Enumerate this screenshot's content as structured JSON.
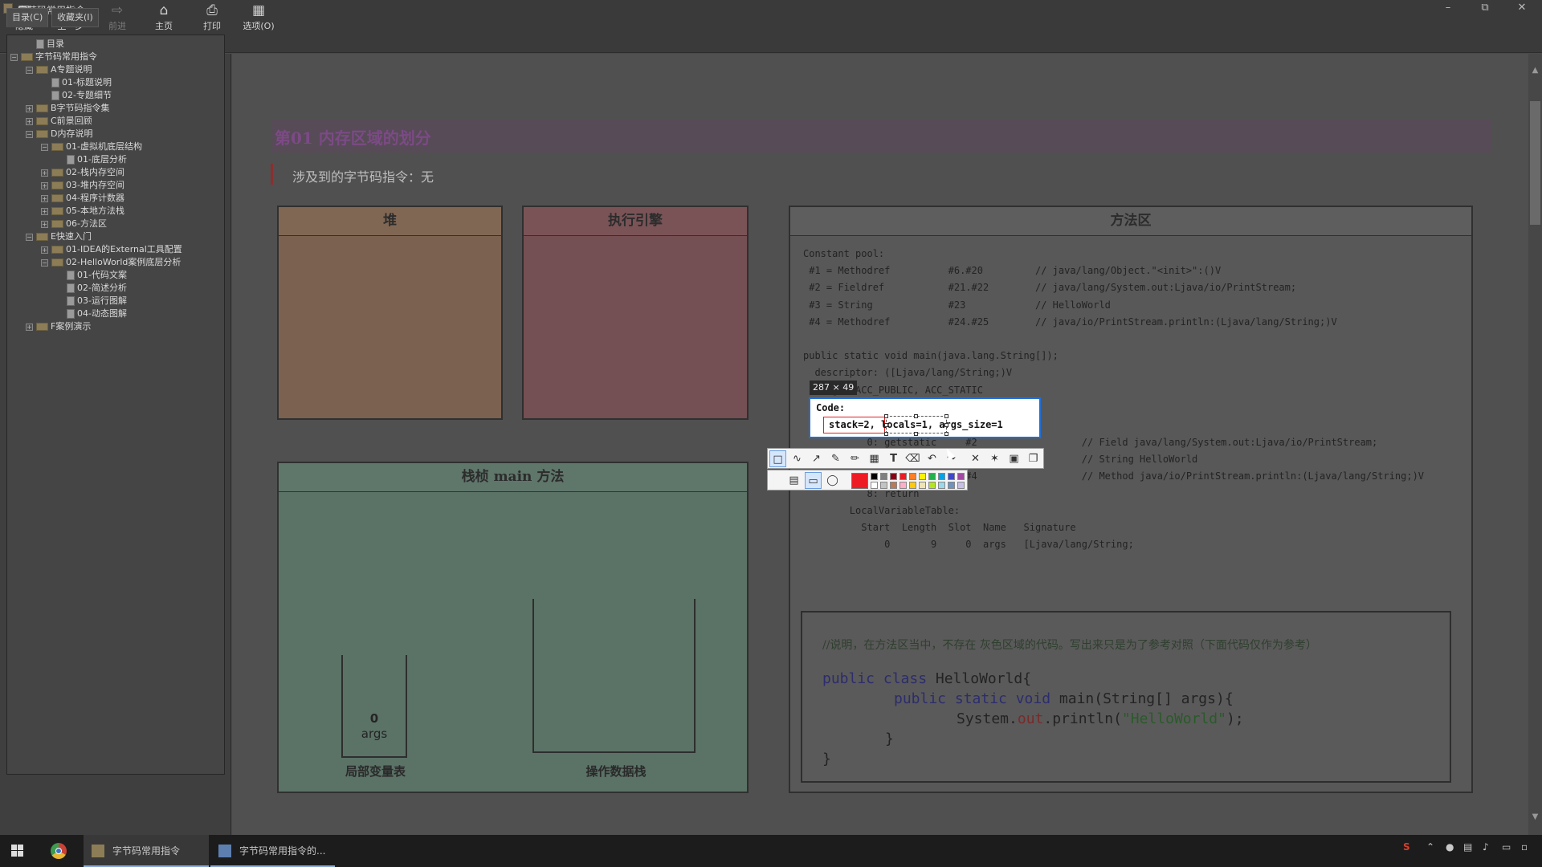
{
  "window": {
    "title": "字节码常用指令"
  },
  "toolbar": {
    "hide": "隐藏",
    "back": "上一步",
    "forward": "前进",
    "home": "主页",
    "print": "打印",
    "options": "选项(O)"
  },
  "sidebar": {
    "tab_contents": "目录(C)",
    "tab_favorites": "收藏夹(I)",
    "tree": [
      {
        "label": "目录",
        "level": 1,
        "kind": "doc"
      },
      {
        "label": "字节码常用指令",
        "level": 0,
        "kind": "folder",
        "expanded": true
      },
      {
        "label": "A专题说明",
        "level": 1,
        "kind": "folder",
        "expanded": true
      },
      {
        "label": "01-标题说明",
        "level": 2,
        "kind": "doc"
      },
      {
        "label": "02-专题细节",
        "level": 2,
        "kind": "doc"
      },
      {
        "label": "B字节码指令集",
        "level": 1,
        "kind": "folder",
        "expanded": false
      },
      {
        "label": "C前景回顾",
        "level": 1,
        "kind": "folder",
        "expanded": false
      },
      {
        "label": "D内存说明",
        "level": 1,
        "kind": "folder",
        "expanded": true
      },
      {
        "label": "01-虚拟机底层结构",
        "level": 2,
        "kind": "folder",
        "expanded": true
      },
      {
        "label": "01-底层分析",
        "level": 3,
        "kind": "doc"
      },
      {
        "label": "02-栈内存空间",
        "level": 2,
        "kind": "folder",
        "expanded": false
      },
      {
        "label": "03-堆内存空间",
        "level": 2,
        "kind": "folder",
        "expanded": false
      },
      {
        "label": "04-程序计数器",
        "level": 2,
        "kind": "folder",
        "expanded": false
      },
      {
        "label": "05-本地方法栈",
        "level": 2,
        "kind": "folder",
        "expanded": false
      },
      {
        "label": "06-方法区",
        "level": 2,
        "kind": "folder",
        "expanded": false
      },
      {
        "label": "E快速入门",
        "level": 1,
        "kind": "folder",
        "expanded": true
      },
      {
        "label": "01-IDEA的External工具配置",
        "level": 2,
        "kind": "folder",
        "expanded": false
      },
      {
        "label": "02-HelloWorld案例底层分析",
        "level": 2,
        "kind": "folder",
        "expanded": true
      },
      {
        "label": "01-代码文案",
        "level": 3,
        "kind": "doc"
      },
      {
        "label": "02-简述分析",
        "level": 3,
        "kind": "doc"
      },
      {
        "label": "03-运行图解",
        "level": 3,
        "kind": "doc"
      },
      {
        "label": "04-动态图解",
        "level": 3,
        "kind": "doc"
      },
      {
        "label": "F案例演示",
        "level": 1,
        "kind": "folder",
        "expanded": false
      }
    ]
  },
  "content": {
    "heading": "第01 内存区域的划分",
    "instructions": "涉及到的字节码指令：无",
    "heap_title": "堆",
    "engine_title": "执行引擎",
    "stack_title": "栈桢 main 方法",
    "local_vars": {
      "value": "0",
      "name": "args",
      "caption": "局部变量表"
    },
    "operand_stack_caption": "操作数据栈",
    "method_area": {
      "title": "方法区",
      "lines": [
        "Constant pool:",
        " #1 = Methodref          #6.#20         // java/lang/Object.\"<init>\":()V",
        " #2 = Fieldref           #21.#22        // java/lang/System.out:Ljava/io/PrintStream;",
        " #3 = String             #23            // HelloWorld",
        " #4 = Methodref          #24.#25        // java/io/PrintStream.println:(Ljava/lang/String;)V",
        "",
        "public static void main(java.lang.String[]);",
        "  descriptor: ([Ljava/lang/String;)V",
        "  flags: ACC_PUBLIC, ACC_STATIC"
      ],
      "code_lines": [
        "           0: getstatic     #2                  // Field java/lang/System.out:Ljava/io/PrintStream;",
        "           3: ldc           #3                  // String HelloWorld",
        "           5: invokevirtual #4                  // Method java/io/PrintStream.println:(Ljava/lang/String;)V",
        "           8: return",
        "        LocalVariableTable:",
        "          Start  Length  Slot  Name   Signature",
        "              0       9     0  args   [Ljava/lang/String;"
      ]
    },
    "explain": {
      "comment": "//说明，在方法区当中，不存在 灰色区域的代码。写出来只是为了参考对照（下面代码仅作为参考）",
      "line1_kw": "public class",
      "line1_rest": " HelloWorld{",
      "line2_kw": "public static void",
      "line2_rest": " main(String[] args){",
      "line3_a": "System.",
      "line3_field": "out",
      "line3_b": ".println(",
      "line3_str": "\"HelloWorld\"",
      "line3_c": ");",
      "line4": "}",
      "line5": "}"
    }
  },
  "screenshot_overlay": {
    "size_label": "287 × 49",
    "code_label": "Code:",
    "selected_text": "stack=2, locals=1, args_size=1",
    "draw_tools": [
      "rect-select-icon",
      "curve-icon",
      "arrow-icon",
      "pen-icon",
      "highlighter-icon",
      "mosaic-icon",
      "text-icon",
      "eraser-icon",
      "undo-icon",
      "redo-icon",
      "close-icon",
      "pin-icon",
      "save-icon",
      "copy-icon"
    ],
    "shape_tools": [
      "hatch-icon",
      "rectangle-icon",
      "ellipse-icon"
    ],
    "colors": [
      "#000000",
      "#7f7f7f",
      "#880015",
      "#ed1c24",
      "#ff7f27",
      "#fff200",
      "#22b14c",
      "#00a2e8",
      "#3f48cc",
      "#a349a4",
      "#ffffff",
      "#c3c3c3",
      "#b97a57",
      "#ffaec9",
      "#ffc90e",
      "#efe4b0",
      "#b5e61d",
      "#99d9ea",
      "#7092be",
      "#c8bfe7"
    ],
    "current_color": "#ed1c24"
  },
  "taskbar": {
    "app1": "字节码常用指令",
    "app2": "字节码常用指令的..."
  }
}
